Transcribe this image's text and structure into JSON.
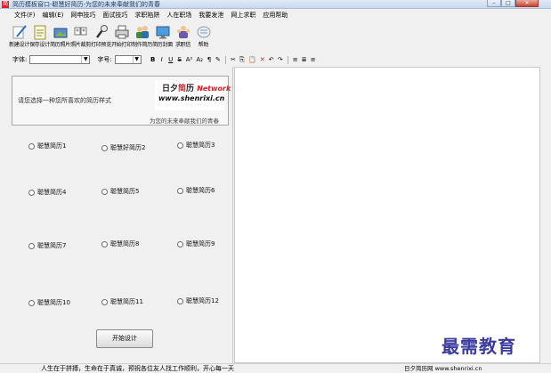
{
  "window": {
    "title": "简历模板窗口-聪慧好简历-为您的未来奉献我们的青春",
    "controls": [
      "–",
      "□",
      "✕"
    ]
  },
  "menu": [
    "文件(F)",
    "编辑(E)",
    "网申技巧",
    "面试技巧",
    "求职陷阱",
    "人在职场",
    "我要发泄",
    "网上求职",
    "应用帮助"
  ],
  "toolbar": [
    {
      "label": "新建设计",
      "icon": "pen-icon"
    },
    {
      "label": "保存设计",
      "icon": "notepad-icon"
    },
    {
      "label": "简历照片",
      "icon": "photo-icon"
    },
    {
      "label": "照片裁剪",
      "icon": "crop-icon"
    },
    {
      "label": "打印预览",
      "icon": "magnifier-icon"
    },
    {
      "label": "开始打印",
      "icon": "printer-icon"
    },
    {
      "label": "制作简历",
      "icon": "people-icon"
    },
    {
      "label": "简历封面",
      "icon": "monitor-icon"
    },
    {
      "label": "求职信",
      "icon": "group-icon"
    },
    {
      "label": "帮助",
      "icon": "help-icon"
    }
  ],
  "formatbar": {
    "font_label": "字体:",
    "size_label": "字号:",
    "font_value": "",
    "size_value": "",
    "buttons": [
      "B",
      "I",
      "U",
      "S",
      "A²",
      "A₂",
      "¶",
      "✎",
      "✂",
      "⎘",
      "📋",
      "✕",
      "↶",
      "↷",
      "≡",
      "≣",
      "≡"
    ]
  },
  "left": {
    "prompt": "请您选择一种您所喜欢的简历样式",
    "logo_line1_a": "日夕",
    "logo_line1_b": "简",
    "logo_line1_c": "历",
    "logo_line1_d": "Network",
    "logo_line2": "www.shenrixi.cn",
    "slogan": "为您的未来奉献我们的青春",
    "options": [
      {
        "label": "聪慧简历1"
      },
      {
        "label": "聪慧好简历2"
      },
      {
        "label": "聪慧简历3"
      },
      {
        "label": "聪慧简历4"
      },
      {
        "label": "聪慧简历5"
      },
      {
        "label": "聪慧简历6"
      },
      {
        "label": "聪慧简历7"
      },
      {
        "label": "聪慧简历8"
      },
      {
        "label": "聪慧简历9"
      },
      {
        "label": "聪慧简历10"
      },
      {
        "label": "聪慧简历11"
      },
      {
        "label": "聪慧简历12"
      }
    ],
    "start_button": "开始设计"
  },
  "status": {
    "motto": "人生在于拼搏，生命在于真诚，预祝各位友人找工作顺利，开心每一天",
    "site": "日夕简历网 www.shenrixi.cn"
  },
  "watermark": "最需教育",
  "colors": {
    "brand_red": "#d2232a",
    "watermark": "#3b3b9e"
  }
}
